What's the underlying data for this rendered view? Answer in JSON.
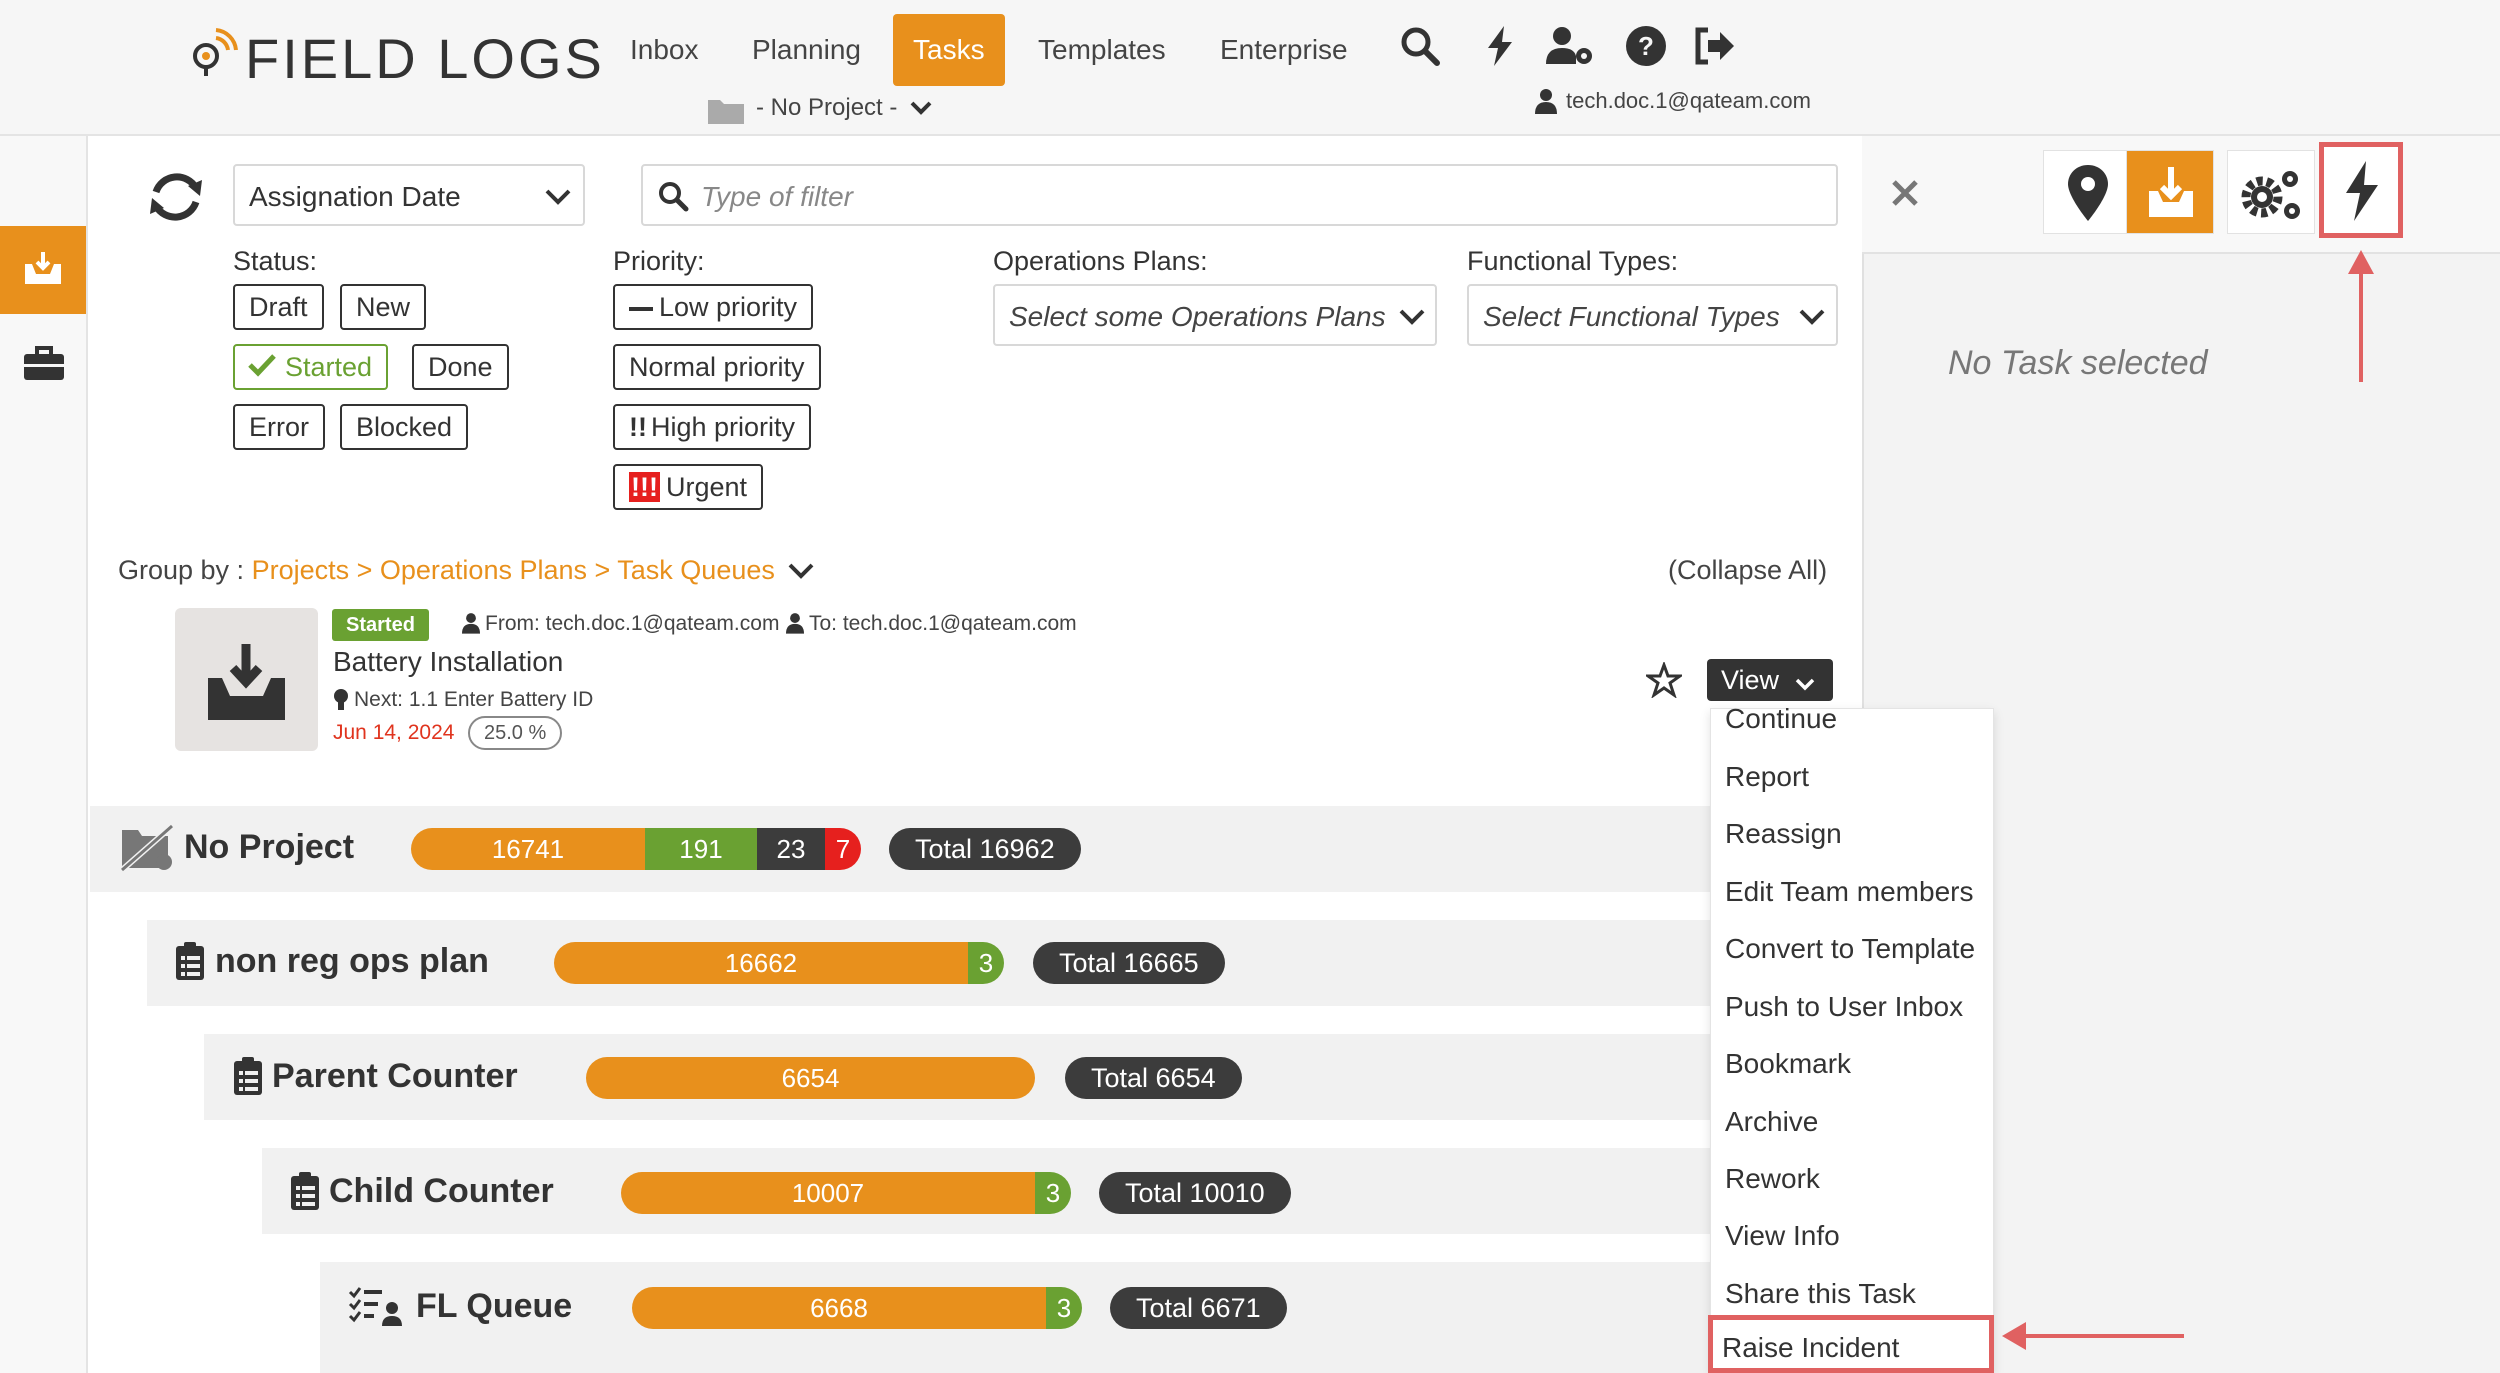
{
  "app": {
    "logo_text": "FIELD LOGS"
  },
  "nav": {
    "items": [
      "Inbox",
      "Planning",
      "Tasks",
      "Templates",
      "Enterprise"
    ],
    "active": "Tasks",
    "project_selector": "- No Project -",
    "user_email": "tech.doc.1@qateam.com",
    "icons": [
      "search-icon",
      "bolt-icon",
      "users-settings-icon",
      "help-icon",
      "logout-icon"
    ]
  },
  "sidebar": {
    "items": [
      "inbox-tray-icon",
      "briefcase-icon"
    ]
  },
  "filters": {
    "sort_select": "Assignation Date",
    "search_placeholder": "Type of filter",
    "status_label": "Status:",
    "status": [
      "Draft",
      "New",
      "Started",
      "Done",
      "Error",
      "Blocked"
    ],
    "status_selected": "Started",
    "priority_label": "Priority:",
    "priority": [
      "Low priority",
      "Normal priority",
      "High priority",
      "Urgent"
    ],
    "ops_plans_label": "Operations Plans:",
    "ops_plans_placeholder": "Select some Operations Plans",
    "functional_types_label": "Functional Types:",
    "functional_types_placeholder": "Select Functional Types"
  },
  "grouping": {
    "label": "Group by :",
    "path": "Projects > Operations Plans > Task Queues",
    "collapse": "(Collapse All)"
  },
  "task": {
    "status": "Started",
    "from": "From: tech.doc.1@qateam.com",
    "to": "To: tech.doc.1@qateam.com",
    "title": "Battery Installation",
    "next": "Next: 1.1 Enter Battery ID",
    "date": "Jun 14, 2024",
    "progress": "25.0 %",
    "view_label": "View"
  },
  "view_menu": {
    "items": [
      "Continue",
      "Report",
      "Reassign",
      "Edit Team members",
      "Convert to Template",
      "Push to User Inbox",
      "Bookmark",
      "Archive",
      "Rework",
      "View Info",
      "Share this Task",
      "Raise Incident"
    ],
    "highlighted": "Raise Incident"
  },
  "groups": [
    {
      "title": "No Project",
      "segments": [
        "16741",
        "191",
        "23",
        "7"
      ],
      "total": "Total 16962"
    },
    {
      "title": "non reg ops plan",
      "segments": [
        "16662",
        "3"
      ],
      "total": "Total 16665"
    },
    {
      "title": "Parent Counter",
      "segments": [
        "6654"
      ],
      "total": "Total 6654"
    },
    {
      "title": "Child Counter",
      "segments": [
        "10007",
        "3"
      ],
      "total": "Total 10010"
    },
    {
      "title": "FL Queue",
      "segments": [
        "6668",
        "3"
      ],
      "total": "Total 6671"
    }
  ],
  "right_panel": {
    "empty_text": "No Task selected",
    "tabs": [
      "location-pin-icon",
      "inbox-tray-icon",
      "gears-icon",
      "bolt-icon"
    ],
    "active_tab": "inbox-tray-icon",
    "highlighted_tab": "bolt-icon"
  },
  "colors": {
    "accent": "#e8901c",
    "success": "#6aa132",
    "danger": "#e6201e",
    "dark": "#3c3c3c",
    "annotation": "#e06161"
  }
}
